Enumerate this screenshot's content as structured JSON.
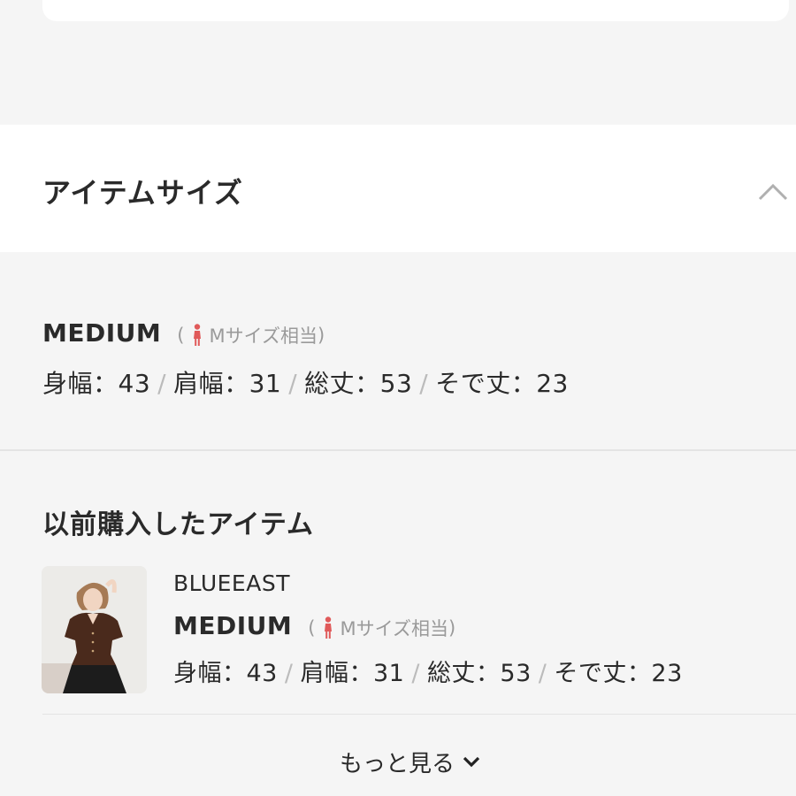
{
  "section": {
    "title": "アイテムサイズ"
  },
  "current_size": {
    "name": "MEDIUM",
    "equiv_open": "(",
    "equiv_label": "Mサイズ相当",
    "equiv_close": ")",
    "measures": [
      {
        "label": "身幅：43"
      },
      {
        "label": "肩幅：31"
      },
      {
        "label": "総丈：53"
      },
      {
        "label": "そで丈：23"
      }
    ]
  },
  "previous_items": {
    "title": "以前購入したアイテム",
    "items": [
      {
        "brand": "BLUEEAST",
        "size_name": "MEDIUM",
        "equiv_open": "(",
        "equiv_label": "Mサイズ相当",
        "equiv_close": ")",
        "measures": [
          {
            "label": "身幅：43"
          },
          {
            "label": "肩幅：31"
          },
          {
            "label": "総丈：53"
          },
          {
            "label": "そで丈：23"
          }
        ]
      }
    ]
  },
  "more_link": {
    "label": "もっと見る"
  },
  "separator": "/",
  "colors": {
    "person_icon": "#e05a5a",
    "text": "#2a2a2a",
    "muted": "#9a9a9a",
    "background": "#f5f5f5"
  },
  "icons": {
    "collapse": "chevron-up-icon",
    "person": "female-person-icon",
    "expand": "chevron-down-icon"
  }
}
